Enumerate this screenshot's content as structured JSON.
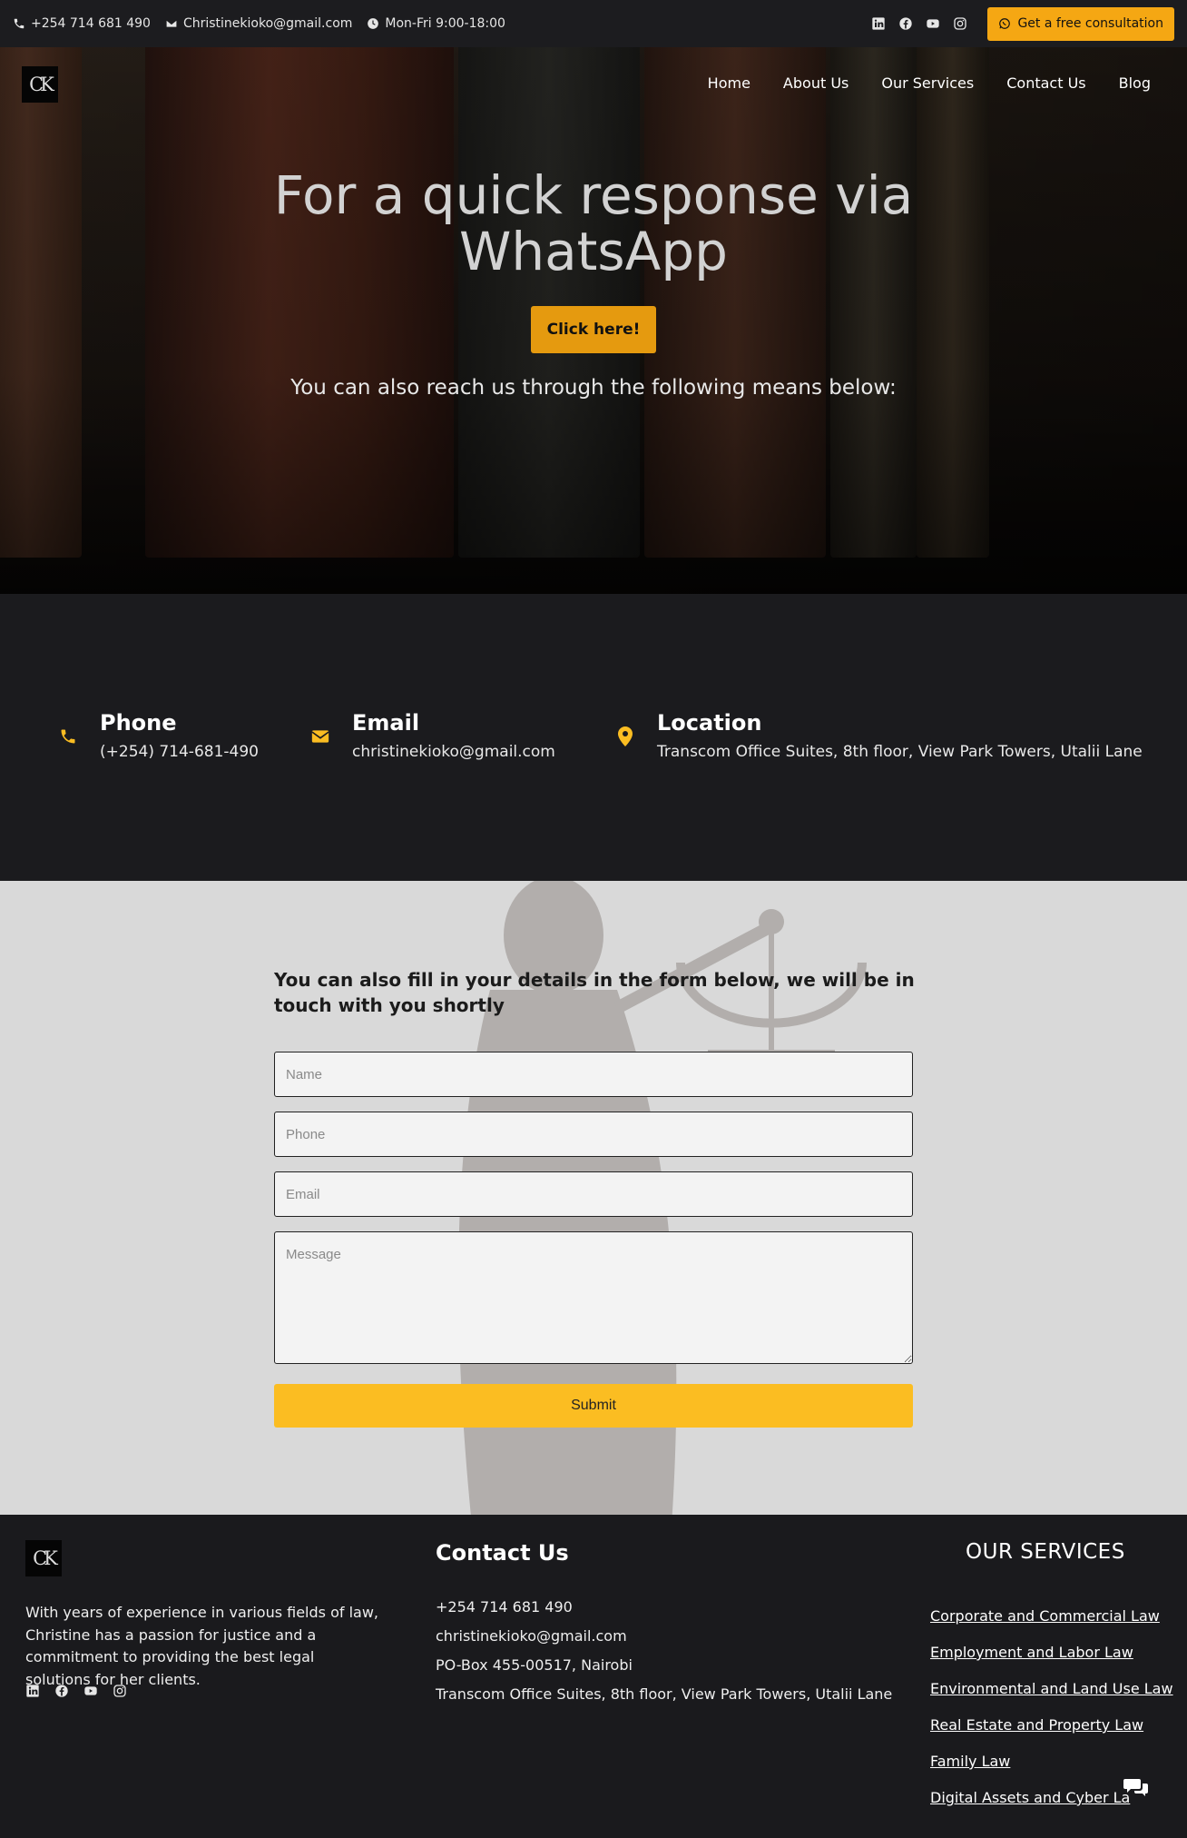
{
  "topbar": {
    "phone": "+254 714 681 490",
    "email": "Christinekioko@gmail.com",
    "hours": "Mon-Fri 9:00-18:00",
    "social_icons": [
      "linkedin-icon",
      "facebook-icon",
      "youtube-icon",
      "instagram-icon"
    ],
    "consult_label": "Get a free consultation"
  },
  "logo": {
    "text": "CK"
  },
  "nav": {
    "items": [
      "Home",
      "About Us",
      "Our Services",
      "Contact Us",
      "Blog"
    ]
  },
  "hero": {
    "title_line1": "For a quick response via",
    "title_line2": "WhatsApp",
    "button_label": "Click here!",
    "subtitle": "You can also reach us through the following means below:"
  },
  "contact_info": {
    "phone": {
      "title": "Phone",
      "value": "(+254) 714-681-490",
      "icon": "phone-icon"
    },
    "email": {
      "title": "Email",
      "value": "christinekioko@gmail.com",
      "icon": "envelope-icon"
    },
    "location": {
      "title": "Location",
      "value": "Transcom Office Suites, 8th floor, View Park Towers, Utalii Lane",
      "icon": "map-pin-icon"
    }
  },
  "form": {
    "title": "You can also fill in your details in the form below, we will be in touch with you shortly",
    "name_placeholder": "Name",
    "phone_placeholder": "Phone",
    "email_placeholder": "Email",
    "message_placeholder": "Message",
    "submit_label": "Submit"
  },
  "footer": {
    "about": "With years of experience in various fields of law, Christine has a passion for justice and a commitment to providing the best legal solutions for her clients.",
    "contact_title": "Contact Us",
    "contact_lines": [
      "+254 714 681 490",
      "christinekioko@gmail.com",
      "PO-Box 455-00517, Nairobi",
      "Transcom Office Suites, 8th floor, View Park Towers, Utalii Lane"
    ],
    "services_title": "OUR SERVICES",
    "services": [
      "Corporate and Commercial Law",
      "Employment and Labor Law",
      "Environmental and Land Use Law",
      "Real Estate and Property Law",
      "Family Law",
      "Digital Assets and Cyber La"
    ]
  },
  "colors": {
    "accent": "#f5a713",
    "submit": "#fbbd22",
    "dark_bg": "#1a1a1d",
    "icon_yellow": "#fbbd22"
  }
}
